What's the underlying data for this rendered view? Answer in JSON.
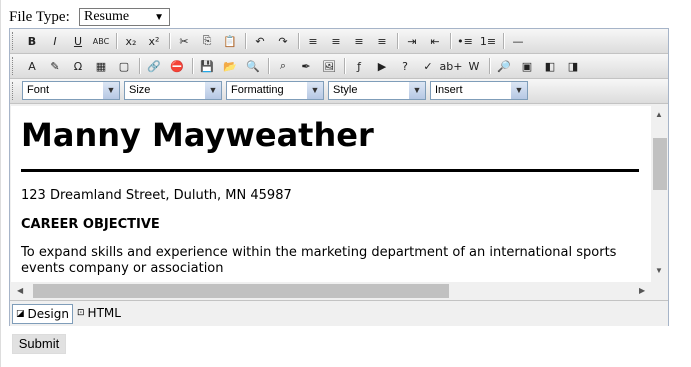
{
  "file_type": {
    "label": "File Type:",
    "value": "Resume"
  },
  "toolbar1": [
    {
      "name": "bold",
      "glyph": "B"
    },
    {
      "name": "italic",
      "glyph": "I"
    },
    {
      "name": "underline",
      "glyph": "U"
    },
    {
      "name": "strikethrough",
      "glyph": "ABC"
    },
    {
      "name": "subscript",
      "glyph": "x₂"
    },
    {
      "name": "superscript",
      "glyph": "x²"
    },
    {
      "name": "cut",
      "glyph": "✂"
    },
    {
      "name": "copy",
      "glyph": "⎘"
    },
    {
      "name": "paste",
      "glyph": "📋"
    },
    {
      "name": "undo",
      "glyph": "↶"
    },
    {
      "name": "redo",
      "glyph": "↷"
    },
    {
      "name": "align-left",
      "glyph": "≡"
    },
    {
      "name": "align-center",
      "glyph": "≡"
    },
    {
      "name": "align-right",
      "glyph": "≡"
    },
    {
      "name": "justify",
      "glyph": "≡"
    },
    {
      "name": "indent",
      "glyph": "⇥"
    },
    {
      "name": "outdent",
      "glyph": "⇤"
    },
    {
      "name": "bulleted-list",
      "glyph": "•≡"
    },
    {
      "name": "numbered-list",
      "glyph": "1≡"
    },
    {
      "name": "horizontal-rule",
      "glyph": "—"
    }
  ],
  "toolbar2": [
    {
      "name": "font-color",
      "glyph": "A"
    },
    {
      "name": "highlight",
      "glyph": "✎"
    },
    {
      "name": "special-chars",
      "glyph": "Ω"
    },
    {
      "name": "table",
      "glyph": "▦"
    },
    {
      "name": "table-props",
      "glyph": "▢"
    },
    {
      "name": "link",
      "glyph": "🔗"
    },
    {
      "name": "unlink",
      "glyph": "⛔"
    },
    {
      "name": "save",
      "glyph": "💾"
    },
    {
      "name": "open",
      "glyph": "📂"
    },
    {
      "name": "preview",
      "glyph": "🔍"
    },
    {
      "name": "find",
      "glyph": "⌕"
    },
    {
      "name": "format-brush",
      "glyph": "✒"
    },
    {
      "name": "image",
      "glyph": "🖼"
    },
    {
      "name": "flash",
      "glyph": "ƒ"
    },
    {
      "name": "media",
      "glyph": "▶"
    },
    {
      "name": "help",
      "glyph": "?"
    },
    {
      "name": "spellcheck",
      "glyph": "✓"
    },
    {
      "name": "word-count",
      "glyph": "ab+"
    },
    {
      "name": "paste-word",
      "glyph": "W"
    },
    {
      "name": "zoom",
      "glyph": "🔎"
    },
    {
      "name": "layer",
      "glyph": "▣"
    },
    {
      "name": "bring-forward",
      "glyph": "◧"
    },
    {
      "name": "send-backward",
      "glyph": "◨"
    }
  ],
  "toolbar3": {
    "font": "Font",
    "size": "Size",
    "formatting": "Formatting",
    "style": "Style",
    "insert": "Insert"
  },
  "document": {
    "name": "Manny Mayweather",
    "address": "123 Dreamland Street, Duluth, MN 45987",
    "heading": "CAREER OBJECTIVE",
    "objective": "To expand skills and experience within the marketing department of an international sports events company or association"
  },
  "modes": {
    "design": "Design",
    "html": "HTML"
  },
  "submit_label": "Submit"
}
